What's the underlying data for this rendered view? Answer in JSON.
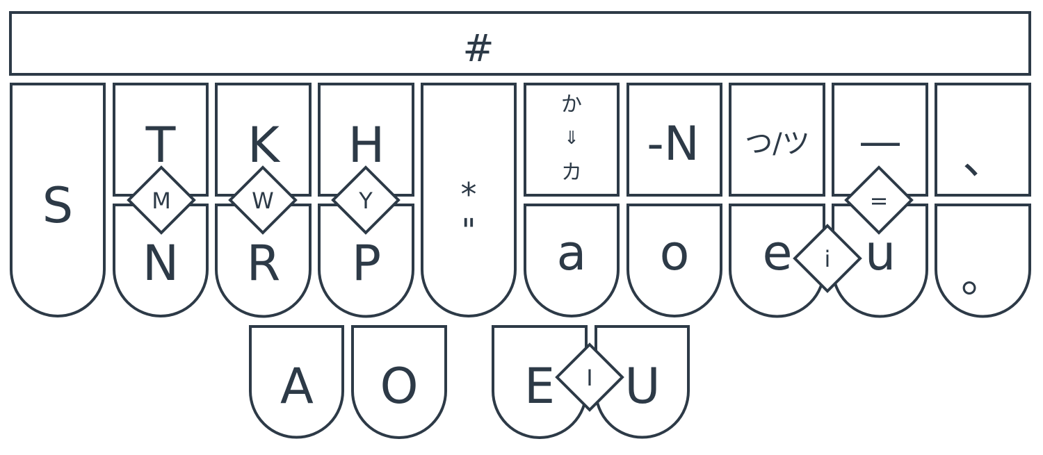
{
  "colors": {
    "stroke": "#2d3a47",
    "background": "#ffffff"
  },
  "number_bar": {
    "label": "#"
  },
  "keys": {
    "S": "S",
    "T": "T",
    "K": "K",
    "H": "H",
    "N": "N",
    "R": "R",
    "P": "P",
    "star_top": "*",
    "star_bottom": "\"",
    "ka_top": "か",
    "ka_arrow": "⇓",
    "ka_bottom": "カ",
    "dash_n": "-N",
    "tsu": "つ/ツ",
    "long_dash": "—",
    "comma": "、",
    "a": "a",
    "o": "o",
    "e": "e",
    "u": "u",
    "period": "。",
    "A": "A",
    "O": "O",
    "E": "E",
    "U": "U"
  },
  "combos": {
    "M": "M",
    "W": "W",
    "Y": "Y",
    "equals": "=",
    "i_lower": "i",
    "I_upper": "I"
  }
}
